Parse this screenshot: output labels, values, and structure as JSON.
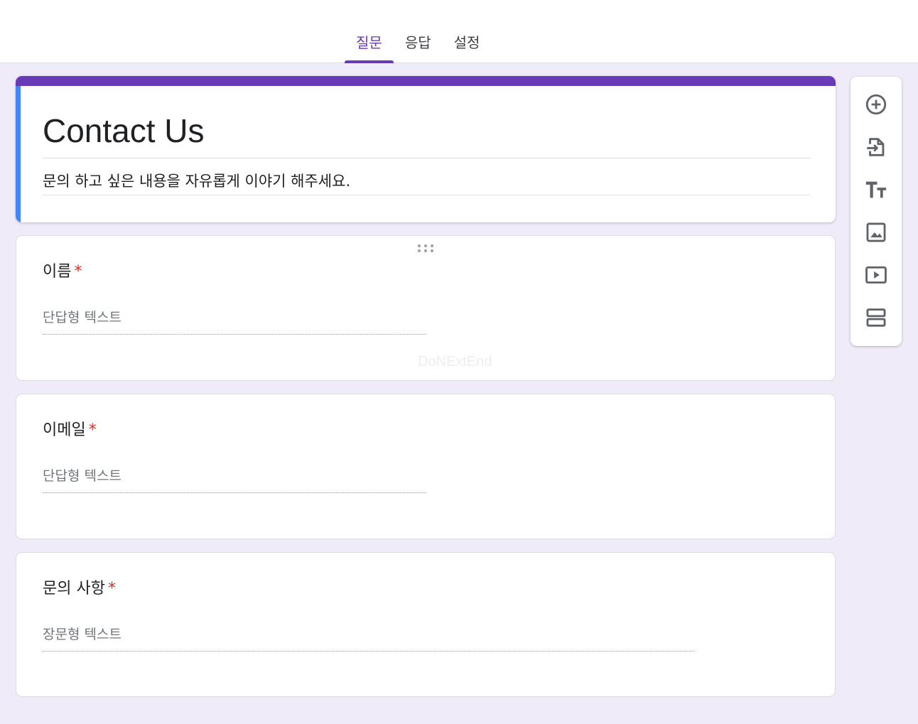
{
  "tabs": [
    {
      "label": "질문",
      "active": true
    },
    {
      "label": "응답"
    },
    {
      "label": "설정"
    }
  ],
  "form": {
    "title": "Contact Us",
    "description": "문의 하고 싶은 내용을 자유롭게 이야기 해주세요."
  },
  "questions": [
    {
      "title": "이름",
      "required_mark": "*",
      "answer_placeholder": "단답형 텍스트"
    },
    {
      "title": "이메일",
      "required_mark": "*",
      "answer_placeholder": "단답형 텍스트"
    },
    {
      "title": "문의 사항",
      "required_mark": "*",
      "answer_placeholder": "장문형 텍스트"
    }
  ],
  "watermark": "DoNExtEnd",
  "toolbar": {
    "icons": [
      "add-question-icon",
      "import-questions-icon",
      "add-title-icon",
      "add-image-icon",
      "add-video-icon",
      "add-section-icon"
    ]
  },
  "colors": {
    "accent": "#673ab7",
    "active_bar": "#4285f4",
    "required": "#d93025",
    "background": "#f0ebf8"
  }
}
